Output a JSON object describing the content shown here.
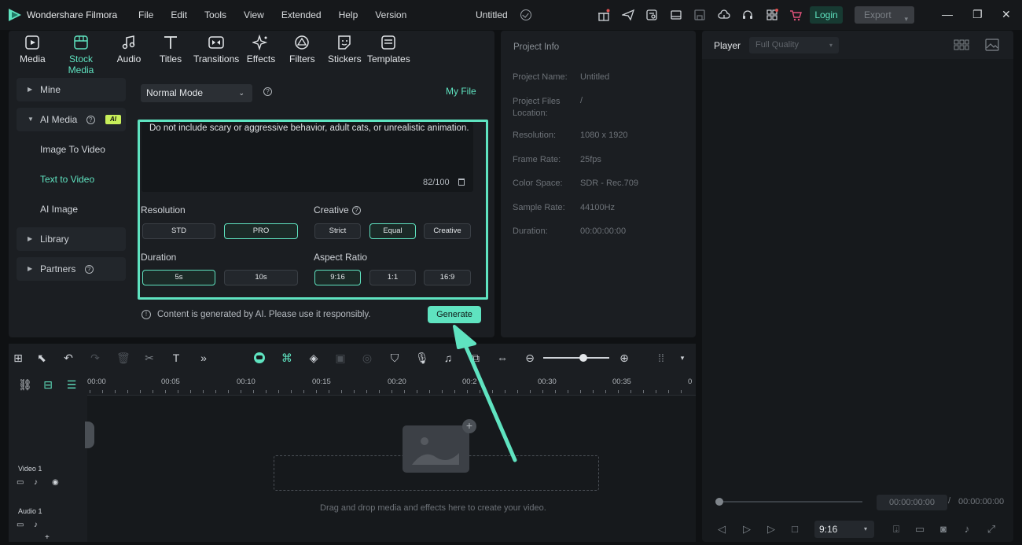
{
  "app": {
    "name": "Wondershare Filmora",
    "doc_title": "Untitled"
  },
  "menu": [
    "File",
    "Edit",
    "Tools",
    "View",
    "Extended",
    "Help",
    "Version"
  ],
  "titlebar": {
    "login_label": "Login",
    "export_label": "Export"
  },
  "tabs": [
    {
      "label": "Media",
      "icon": "media-icon"
    },
    {
      "label": "Stock Media",
      "icon": "stock-media-icon",
      "active": true
    },
    {
      "label": "Audio",
      "icon": "music-note-icon"
    },
    {
      "label": "Titles",
      "icon": "text-t-icon"
    },
    {
      "label": "Transitions",
      "icon": "transitions-icon"
    },
    {
      "label": "Effects",
      "icon": "sparkle-icon"
    },
    {
      "label": "Filters",
      "icon": "filter-icon"
    },
    {
      "label": "Stickers",
      "icon": "sticker-icon"
    },
    {
      "label": "Templates",
      "icon": "templates-icon"
    }
  ],
  "sidebar": {
    "mine": "Mine",
    "ai_media": "AI Media",
    "ai_badge": "AI",
    "image_to_video": "Image To Video",
    "text_to_video": "Text to Video",
    "ai_image": "AI Image",
    "library": "Library",
    "partners": "Partners"
  },
  "generator": {
    "mode": "Normal Mode",
    "my_file": "My File",
    "prompt": "Do not include scary or aggressive behavior, adult cats, or unrealistic animation.",
    "char_count": "82/100",
    "resolution_label": "Resolution",
    "resolution_options": [
      "STD",
      "PRO"
    ],
    "resolution_selected": "PRO",
    "creative_label": "Creative",
    "creative_options": [
      "Strict",
      "Equal",
      "Creative"
    ],
    "creative_selected": "Equal",
    "duration_label": "Duration",
    "duration_options": [
      "5s",
      "10s"
    ],
    "duration_selected": "5s",
    "aspect_label": "Aspect Ratio",
    "aspect_options": [
      "9:16",
      "1:1",
      "16:9"
    ],
    "aspect_selected": "9:16",
    "notice": "Content is generated by AI. Please use it responsibly.",
    "generate_label": "Generate"
  },
  "project_info": {
    "title": "Project Info",
    "rows": [
      {
        "label": "Project Name:",
        "value": "Untitled"
      },
      {
        "label": "Project Files Location:",
        "value": "/"
      },
      {
        "label": "Resolution:",
        "value": "1080 x 1920"
      },
      {
        "label": "Frame Rate:",
        "value": "25fps"
      },
      {
        "label": "Color Space:",
        "value": "SDR - Rec.709"
      },
      {
        "label": "Sample Rate:",
        "value": "44100Hz"
      },
      {
        "label": "Duration:",
        "value": "00:00:00:00"
      }
    ]
  },
  "player": {
    "label": "Player",
    "quality": "Full Quality",
    "current_time": "00:00:00:00",
    "separator": "/",
    "total_time": "00:00:00:00",
    "ratio": "9:16"
  },
  "timeline": {
    "ticks": [
      "00:00",
      "00:05",
      "00:10",
      "00:15",
      "00:20",
      "00:2",
      "00:30",
      "00:35",
      "0"
    ],
    "video_track": "Video 1",
    "audio_track": "Audio 1",
    "drop_text": "Drag and drop media and effects here to create your video."
  },
  "colors": {
    "accent": "#5fe3c0",
    "bg": "#0f1113",
    "panel": "#1b1e22"
  }
}
